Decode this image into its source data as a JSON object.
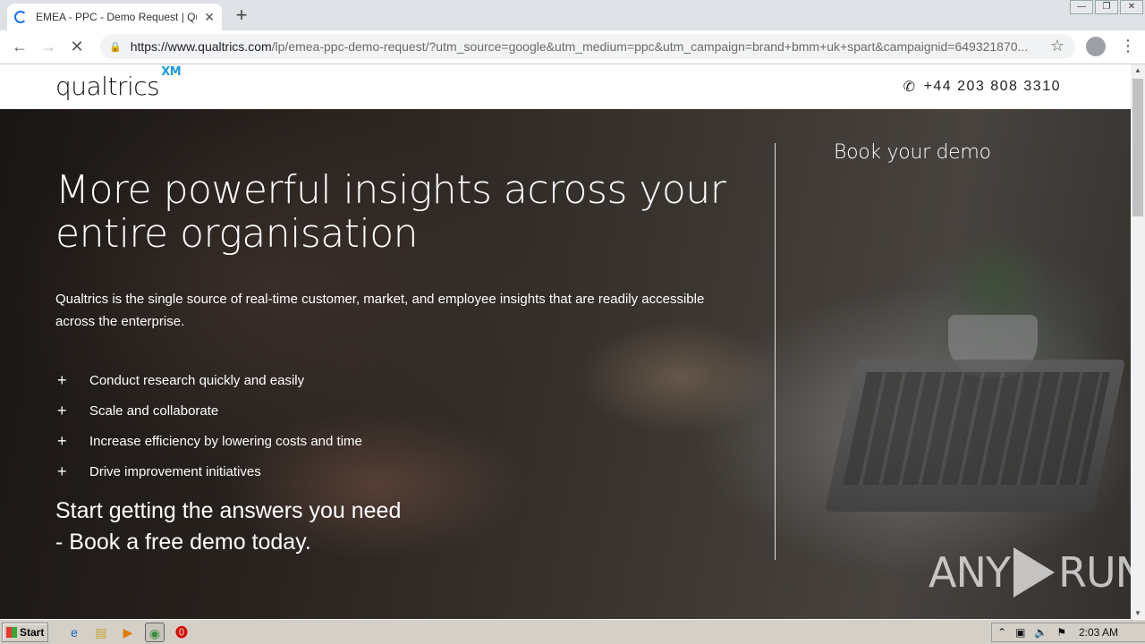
{
  "browser": {
    "tab_title": "EMEA - PPC - Demo Request | Qualtrics",
    "url_host": "https://www.qualtrics.com",
    "url_path": "/lp/emea-ppc-demo-request/?utm_source=google&utm_medium=ppc&utm_campaign=brand+bmm+uk+spart&campaignid=649321870..."
  },
  "header": {
    "logo_text": "qualtrics",
    "logo_sup": "XM",
    "phone": "+44 203 808 3310"
  },
  "hero": {
    "headline": "More powerful insights across your entire organisation",
    "lead": "Qualtrics is the single source of real-time customer, market, and employee insights that are readily accessible across the enterprise.",
    "benefits": [
      "Conduct research quickly and easily",
      "Scale and collaborate",
      "Increase efficiency by lowering costs and time",
      "Drive improvement initiatives"
    ],
    "cta_line1": "Start getting the answers you need",
    "cta_line2": "- Book a free demo today.",
    "side_title": "Book your demo"
  },
  "watermark": {
    "left": "ANY",
    "right": "RUN"
  },
  "taskbar": {
    "start_label": "Start",
    "clock": "2:03 AM"
  },
  "colors": {
    "accent": "#1a9ce0",
    "hero_dark": "#2d2622"
  }
}
